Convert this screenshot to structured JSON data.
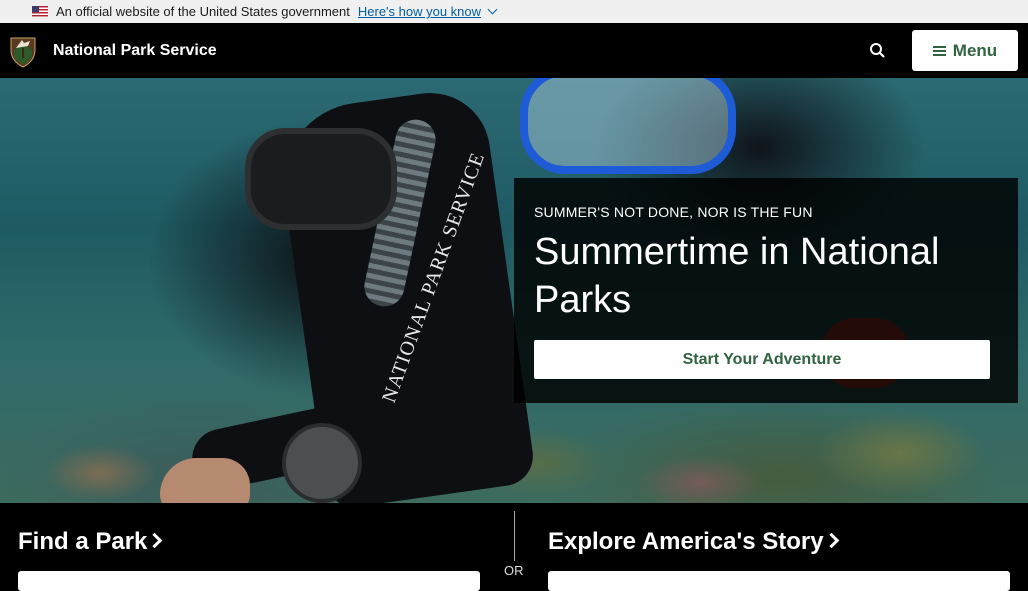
{
  "gov_banner": {
    "text": "An official website of the United States government",
    "link": "Here's how you know"
  },
  "header": {
    "site_title": "National Park Service",
    "menu_label": "Menu"
  },
  "hero": {
    "eyebrow": "SUMMER'S NOT DONE, NOR IS THE FUN",
    "title": "Summertime in National Parks",
    "cta_label": "Start Your Adventure",
    "image_sleeve_text": "NATIONAL PARK SERVICE"
  },
  "bottom": {
    "find_park": "Find a Park",
    "or_label": "OR",
    "explore": "Explore America's Story"
  },
  "colors": {
    "nps_green": "#30633f",
    "gov_link_blue": "#005ea2",
    "header_bg": "#000000",
    "gov_banner_bg": "#f0f0f0"
  }
}
